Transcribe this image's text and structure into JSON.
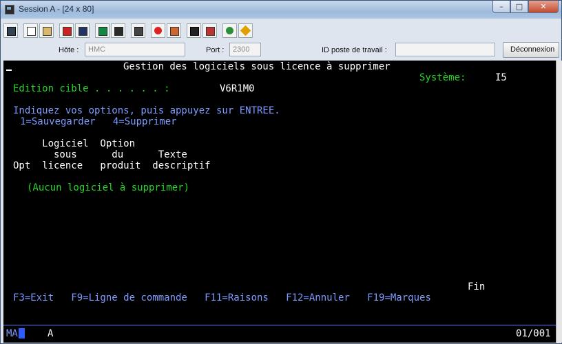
{
  "window": {
    "title": "Session A - [24 x 80]"
  },
  "winbtns": {
    "minimize": "–",
    "maximize": "□",
    "close": "✕"
  },
  "toolbar": {
    "icons": [
      "print-screen-icon",
      "copy-icon",
      "paste-icon",
      "send-icon",
      "receive-icon",
      "display-icon",
      "keypad-icon",
      "macro-icon",
      "record-icon",
      "play-icon",
      "stop-icon",
      "transfer-icon",
      "globe-icon",
      "help-icon"
    ]
  },
  "connection": {
    "host_label": "Hôte :",
    "host_value": "HMC",
    "port_label": "Port :",
    "port_value": "2300",
    "workstation_label": "ID poste de travail :",
    "workstation_value": "",
    "disconnect_label": "Déconnexion"
  },
  "screen": {
    "title": "Gestion des logiciels sous licence à supprimer",
    "system_label": "Système:",
    "system_value": "I5",
    "edition_label": "Edition cible . . . . . . :",
    "edition_value": "V6R1M0",
    "instructions": "Indiquez vos options, puis appuyez sur ENTREE.",
    "options": "1=Sauvegarder   4=Supprimer",
    "col_header_1": "     Logiciel  Option",
    "col_header_2": "       sous      du      Texte",
    "col_header_3": "Opt  licence   produit  descriptif",
    "empty_message": "(Aucun logiciel à supprimer)",
    "fin": "Fin",
    "fkeys": "F3=Exit   F9=Ligne de commande   F11=Raisons   F12=Annuler   F19=Marques"
  },
  "status": {
    "left": "MA",
    "mode": "A",
    "position": "01/001"
  },
  "colors": {
    "green": "#26d626",
    "blue": "#7d9bff",
    "white": "#ffffff",
    "background": "#000000"
  }
}
